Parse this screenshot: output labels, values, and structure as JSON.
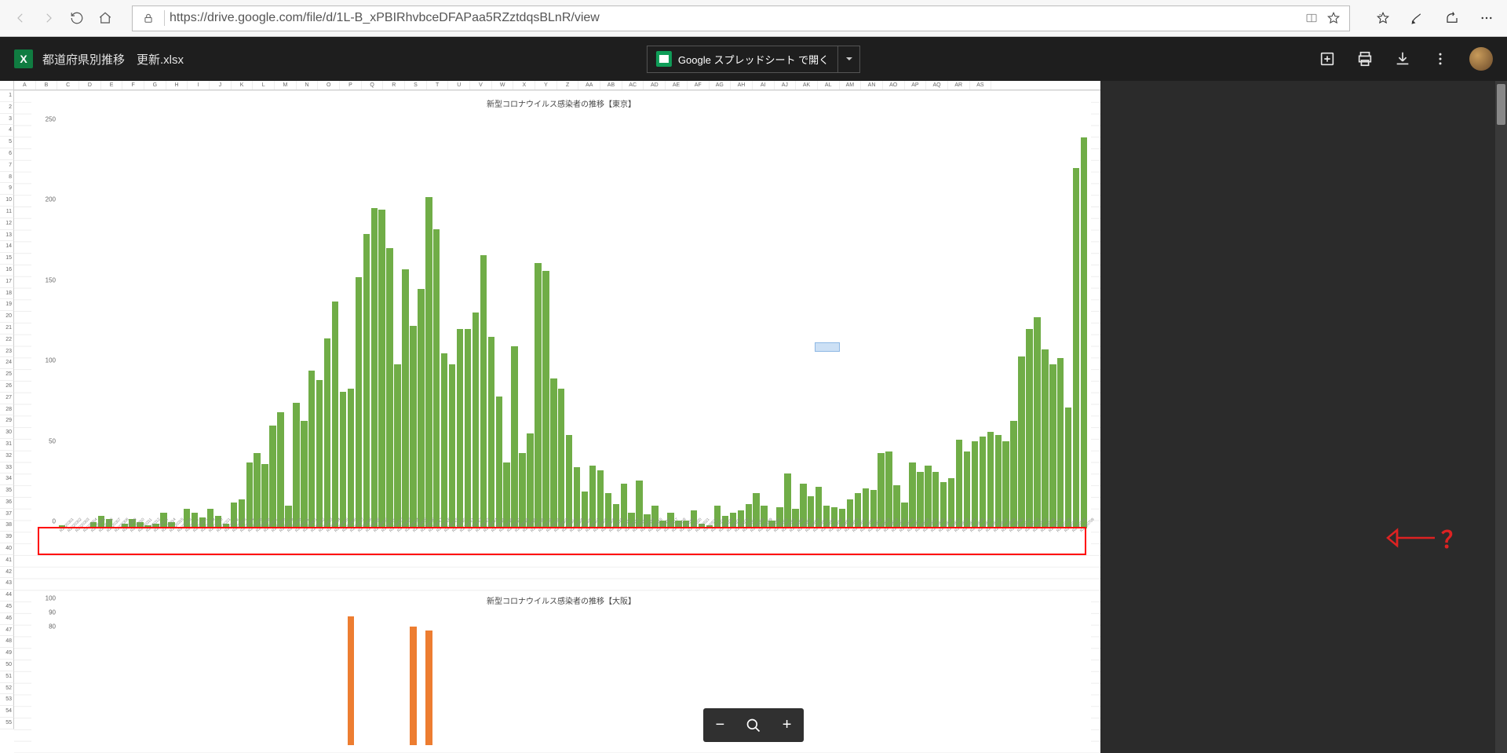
{
  "browser": {
    "url": "https://drive.google.com/file/d/1L-B_xPBIRhvbceDFAPaa5RZztdqsBLnR/view"
  },
  "file": {
    "name": "都道府県別推移　更新.xlsx",
    "icon_text": "X"
  },
  "header": {
    "open_with": "Google スプレッドシート で開く",
    "actions": {
      "add": "add",
      "print": "print",
      "download": "download",
      "more": "more"
    }
  },
  "columns": [
    "A",
    "B",
    "C",
    "D",
    "E",
    "F",
    "G",
    "H",
    "I",
    "J",
    "K",
    "L",
    "M",
    "N",
    "O",
    "P",
    "Q",
    "R",
    "S",
    "T",
    "U",
    "V",
    "W",
    "X",
    "Y",
    "Z",
    "AA",
    "AB",
    "AC",
    "AD",
    "AE",
    "AF",
    "AG",
    "AH",
    "AI",
    "AJ",
    "AK",
    "AL",
    "AM",
    "AN",
    "AO",
    "AP",
    "AQ",
    "AR",
    "AS"
  ],
  "row_count": 55,
  "annotation": {
    "question": "？"
  },
  "zoom": {
    "minus": "−",
    "plus": "+"
  },
  "chart_data": [
    {
      "type": "bar",
      "title": "新型コロナウイルス感染者の推移【東京】",
      "ylabel": "",
      "xlabel": "",
      "ylim": [
        0,
        260
      ],
      "yticks": [
        0,
        50,
        100,
        150,
        200,
        250
      ],
      "bar_color": "#70ad47",
      "categories": [
        "R2020301",
        "R2020302",
        "R2020303",
        "R2020304",
        "R2020305",
        "R2020306",
        "R2020307",
        "R2020308",
        "R2020309",
        "R2020310",
        "R2020311",
        "R2020312",
        "R2020313",
        "R2020314",
        "R2020315",
        "R2020316",
        "R2020317",
        "R2020318",
        "R2020319",
        "R2020320",
        "R2020321",
        "R2020322",
        "R2020323",
        "R2020324",
        "R2020325",
        "R2020326",
        "R2020327",
        "R2020328",
        "R2020329",
        "R2020330",
        "R2020331",
        "R2020401",
        "R2020402",
        "R2020403",
        "R2020404",
        "R2020405",
        "R2020406",
        "R2020407",
        "R2020408",
        "R2020409",
        "R2020410",
        "R2020411",
        "R2020412",
        "R2020413",
        "R2020414",
        "R2020415",
        "R2020416",
        "R2020417",
        "R2020418",
        "R2020419",
        "R2020420",
        "R2020421",
        "R2020422",
        "R2020423",
        "R2020424",
        "R2020425",
        "R2020426",
        "R2020427",
        "R2020428",
        "R2020429",
        "R2020430",
        "R2020501",
        "R2020502",
        "R2020503",
        "R2020504",
        "R2020505",
        "R2020506",
        "R2020507",
        "R2020508",
        "R2020509",
        "R2020510",
        "R2020511",
        "R2020512",
        "R2020513",
        "R2020514",
        "R2020515",
        "R2020516",
        "R2020517",
        "R2020518",
        "R2020519",
        "R2020520",
        "R2020521",
        "R2020522",
        "R2020523",
        "R2020524",
        "R2020525",
        "R2020526",
        "R2020527",
        "R2020528",
        "R2020529",
        "R2020530",
        "R2020531",
        "R2020601",
        "R2020602",
        "R2020603",
        "R2020604",
        "R2020605",
        "R2020606",
        "R2020607",
        "R2020608",
        "R2020609",
        "R2020610",
        "R2020611",
        "R2020612",
        "R2020613",
        "R2020614",
        "R2020615",
        "R2020616",
        "R2020617",
        "R2020618",
        "R2020619",
        "R2020620",
        "R2020621",
        "R2020622",
        "R2020623",
        "R2020624",
        "R2020625",
        "R2020626",
        "R2020627",
        "R2020628",
        "R2020629",
        "R2020630",
        "R2020701",
        "R2020702",
        "R2020703",
        "R2020704",
        "R2020705",
        "R2020706",
        "R2020707",
        "R2020708",
        "R2020709"
      ],
      "values": [
        2,
        1,
        1,
        0,
        4,
        8,
        6,
        0,
        3,
        6,
        4,
        2,
        3,
        10,
        4,
        0,
        12,
        10,
        7,
        12,
        8,
        3,
        16,
        18,
        41,
        47,
        40,
        64,
        72,
        14,
        78,
        67,
        98,
        92,
        118,
        141,
        85,
        87,
        156,
        183,
        199,
        198,
        174,
        102,
        161,
        126,
        149,
        206,
        186,
        109,
        102,
        124,
        124,
        134,
        170,
        119,
        82,
        41,
        113,
        47,
        59,
        165,
        160,
        93,
        87,
        58,
        38,
        23,
        39,
        36,
        22,
        15,
        28,
        10,
        30,
        9,
        14,
        5,
        10,
        5,
        5,
        11,
        3,
        2,
        14,
        8,
        10,
        11,
        15,
        22,
        14,
        5,
        13,
        34,
        12,
        28,
        20,
        26,
        14,
        13,
        12,
        18,
        22,
        25,
        24,
        47,
        48,
        27,
        16,
        41,
        35,
        39,
        35,
        29,
        31,
        55,
        48,
        54,
        57,
        60,
        58,
        54,
        67,
        107,
        124,
        131,
        111,
        102,
        106,
        75,
        224,
        243
      ],
      "selection_highlight": {
        "x_index": 97,
        "y_value": 110
      }
    },
    {
      "type": "bar",
      "title": "新型コロナウイルス感染者の推移【大阪】",
      "ylabel": "",
      "xlabel": "",
      "ylim": [
        0,
        100
      ],
      "yticks": [
        80,
        90,
        100
      ],
      "bar_color": "#ed7d31",
      "categories": [],
      "values": [
        0,
        0,
        0,
        0,
        0,
        0,
        0,
        0,
        0,
        0,
        0,
        0,
        0,
        0,
        0,
        0,
        0,
        0,
        0,
        0,
        0,
        0,
        0,
        0,
        0,
        0,
        0,
        0,
        0,
        0,
        0,
        0,
        0,
        0,
        0,
        0,
        0,
        92,
        0,
        0,
        0,
        0,
        0,
        0,
        0,
        85,
        0,
        82,
        0,
        0,
        0,
        0,
        0,
        0,
        0,
        0,
        0,
        0,
        0,
        0,
        0,
        0,
        0,
        0,
        0,
        0,
        0,
        0,
        0,
        0,
        0,
        0,
        0,
        0,
        0,
        0,
        0,
        0,
        0,
        0,
        0,
        0,
        0,
        0,
        0,
        0,
        0,
        0,
        0,
        0,
        0,
        0,
        0,
        0,
        0,
        0,
        0,
        0,
        0,
        0,
        0,
        0,
        0,
        0,
        0,
        0,
        0,
        0,
        0,
        0,
        0,
        0,
        0,
        0,
        0,
        0,
        0,
        0,
        0,
        0,
        0,
        0,
        0,
        0,
        0,
        0,
        0,
        0,
        0,
        0,
        0,
        0
      ]
    }
  ]
}
